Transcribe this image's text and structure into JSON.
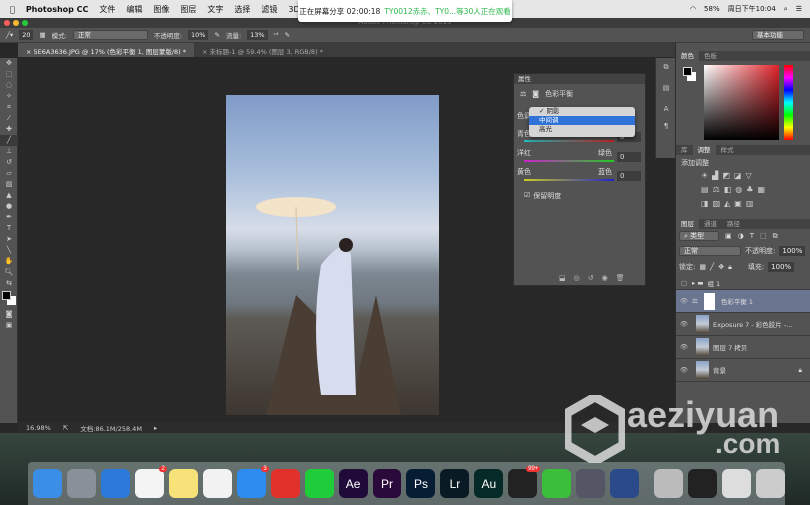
{
  "menubar": {
    "apple": "",
    "app": "Photoshop CC",
    "items": [
      "文件",
      "编辑",
      "图像",
      "图层",
      "文字",
      "选择",
      "滤镜",
      "3D"
    ],
    "battery": "58%",
    "clock": "周日下午10:04"
  },
  "notification": {
    "text": "正在屏幕分享 02:00:18",
    "highlight": "TY0012赤赤、TY0...等30人正在观看"
  },
  "titlebar": {
    "title": "Adobe Photoshop CC 2015"
  },
  "options": {
    "brush_size": "20",
    "mode_label": "模式:",
    "mode": "正常",
    "opacity_label": "不透明度:",
    "opacity": "10%",
    "flow_label": "流量:",
    "flow": "13%",
    "workspace": "基本功能"
  },
  "tabs": [
    {
      "label": "5E6A3636.JPG @ 17% (色彩平衡 1, 图层蒙版/8) *"
    },
    {
      "label": "未标题-1 @ 59.4% (图层 3, RGB/8) *"
    }
  ],
  "properties": {
    "panel_title": "属性",
    "adjustment": "色彩平衡",
    "tone_label": "色调",
    "tone_options": [
      "阴影",
      "中间调",
      "高光"
    ],
    "selected_tone": "中间调",
    "checked_tone": "阴影",
    "sliders": [
      {
        "left": "青色",
        "right": "红色",
        "value": "0"
      },
      {
        "left": "洋红",
        "right": "绿色",
        "value": "0"
      },
      {
        "left": "黄色",
        "right": "蓝色",
        "value": "0"
      }
    ],
    "preserve_luminosity": "保留明度",
    "preserve_checked": true
  },
  "color_panel": {
    "tabs": [
      "颜色",
      "色板"
    ]
  },
  "adjustments_panel": {
    "tabs": [
      "库",
      "调整",
      "样式"
    ],
    "add_label": "添加调整"
  },
  "layers_panel": {
    "tabs": [
      "图层",
      "通道",
      "路径"
    ],
    "filter": "类型",
    "blend": "正常",
    "opacity_label": "不透明度:",
    "opacity": "100%",
    "lock_label": "锁定:",
    "fill_label": "填充:",
    "fill": "100%",
    "layers": [
      {
        "name": "组 1",
        "type": "group"
      },
      {
        "name": "色彩平衡 1",
        "type": "adjustment",
        "selected": true
      },
      {
        "name": "Exposure 7 - 彩色胶片 -...",
        "type": "image"
      },
      {
        "name": "图层 7 拷贝",
        "type": "image"
      },
      {
        "name": "背景",
        "type": "image",
        "locked": true
      }
    ]
  },
  "statusbar": {
    "zoom": "16.98%",
    "doc": "文档:86.1M/258.4M"
  },
  "dock": [
    {
      "label": "Finder",
      "color": "#3a8ee6"
    },
    {
      "label": "Launchpad",
      "color": "#8a9099"
    },
    {
      "label": "Safari",
      "color": "#2b7ad9"
    },
    {
      "label": "Reminders",
      "color": "#f4f4f4",
      "badge": "2"
    },
    {
      "label": "Notes",
      "color": "#f7e27a"
    },
    {
      "label": "Photos",
      "color": "#f2f2f2"
    },
    {
      "label": "App Store",
      "color": "#2c8cf0",
      "badge": "3"
    },
    {
      "label": "NetEase Music",
      "color": "#e0322b"
    },
    {
      "label": "iQIYI",
      "color": "#1fcc3a"
    },
    {
      "label": "Ae",
      "color": "#1f0a3a"
    },
    {
      "label": "Pr",
      "color": "#2a0a3a"
    },
    {
      "label": "Ps",
      "color": "#071d33"
    },
    {
      "label": "Lr",
      "color": "#0a1a24"
    },
    {
      "label": "Au",
      "color": "#062a28"
    },
    {
      "label": "QQ",
      "color": "#222",
      "badge": "99+"
    },
    {
      "label": "WeChat",
      "color": "#3bbf3b"
    },
    {
      "label": "Capture",
      "color": "#556"
    },
    {
      "label": "QuickTime",
      "color": "#2a4a8a"
    },
    {
      "label": "Folder",
      "color": "#bbb"
    },
    {
      "label": "Screen",
      "color": "#222"
    },
    {
      "label": "Preview",
      "color": "#ddd"
    },
    {
      "label": "Trash",
      "color": "#ccc"
    }
  ],
  "watermark": {
    "text": "aeziyuan",
    "suffix": ".com"
  }
}
